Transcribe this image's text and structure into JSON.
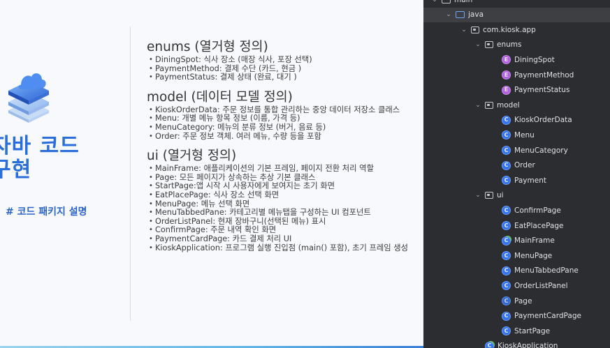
{
  "slide": {
    "title_line1": "자바 코드",
    "title_line2": "구현",
    "subtitle": "# 코드 패키지 설명",
    "sections": [
      {
        "title": "enums (열거형 정의)",
        "items": [
          "DiningSpot: 식사 장소 (매장 식사, 포장 선택)",
          "PaymentMethod: 결제 수단 (카드, 현금 )",
          "PaymentStatus: 결제 상태 (완료, 대기 )"
        ]
      },
      {
        "title": "model (데이터 모델 정의)",
        "items": [
          "KioskOrderData: 주문 정보를 통합 관리하는 중앙 데이터 저장소 클래스",
          "Menu: 개별 메뉴 항목 정보 (이름, 가격 등)",
          "MenuCategory: 메뉴의 분류 정보 (버거, 음료 등)",
          "Order: 주문 정보 객체. 여러 메뉴, 수량 등을 포함"
        ]
      },
      {
        "title": "ui (열거형 정의)",
        "items": [
          "MainFrame: 애플리케이션의 기본 프레임, 페이지 전환 처리 역할",
          "Page: 모든 페이지가 상속하는 추상 기본 클래스",
          "StartPage:앱 시작 시 사용자에게 보여지는 초기 화면",
          "EatPlacePage: 식사 장소 선택 화면",
          "MenuPage: 메뉴 선택 화면",
          "MenuTabbedPane: 카테고리별 메뉴탭을 구성하는 UI 컴포넌트",
          "OrderListPanel: 현재 장바구니(선택된 메뉴) 표시",
          "ConfirmPage: 주문 내역 확인 화면",
          "PaymentCardPage: 카드 결제 처리 UI",
          "KioskApplication: 프로그램 실행 진입점 (main() 포함), 초기 프레임 생성"
        ]
      }
    ]
  },
  "tree": {
    "rows": [
      {
        "label": "main",
        "kind": "folder",
        "indent": 0,
        "expanded": true,
        "partial": true
      },
      {
        "label": "java",
        "kind": "folder-blue",
        "indent": 1,
        "expanded": true,
        "selected": true
      },
      {
        "label": "com.kiosk.app",
        "kind": "package",
        "indent": 2,
        "expanded": true
      },
      {
        "label": "enums",
        "kind": "package",
        "indent": 3,
        "expanded": true
      },
      {
        "label": "DiningSpot",
        "kind": "enum",
        "indent": 4
      },
      {
        "label": "PaymentMethod",
        "kind": "enum",
        "indent": 4
      },
      {
        "label": "PaymentStatus",
        "kind": "enum",
        "indent": 4
      },
      {
        "label": "model",
        "kind": "package",
        "indent": 3,
        "expanded": true
      },
      {
        "label": "KioskOrderData",
        "kind": "class",
        "indent": 4
      },
      {
        "label": "Menu",
        "kind": "class",
        "indent": 4
      },
      {
        "label": "MenuCategory",
        "kind": "class",
        "indent": 4
      },
      {
        "label": "Order",
        "kind": "class",
        "indent": 4
      },
      {
        "label": "Payment",
        "kind": "class",
        "indent": 4
      },
      {
        "label": "ui",
        "kind": "package",
        "indent": 3,
        "expanded": true
      },
      {
        "label": "ConfirmPage",
        "kind": "class",
        "indent": 4
      },
      {
        "label": "EatPlacePage",
        "kind": "class",
        "indent": 4
      },
      {
        "label": "MainFrame",
        "kind": "main-class",
        "indent": 4
      },
      {
        "label": "MenuPage",
        "kind": "class",
        "indent": 4
      },
      {
        "label": "MenuTabbedPane",
        "kind": "class",
        "indent": 4
      },
      {
        "label": "OrderListPanel",
        "kind": "class",
        "indent": 4
      },
      {
        "label": "Page",
        "kind": "abstract-class",
        "indent": 4
      },
      {
        "label": "PaymentCardPage",
        "kind": "class",
        "indent": 4
      },
      {
        "label": "StartPage",
        "kind": "class",
        "indent": 4
      },
      {
        "label": "KioskApplication",
        "kind": "main-class",
        "indent": 3
      }
    ]
  },
  "colors": {
    "accent": "#2a6edb",
    "tree_bg": "#2b2d30",
    "class_icon": "#3574f0",
    "enum_icon": "#b160e0"
  }
}
